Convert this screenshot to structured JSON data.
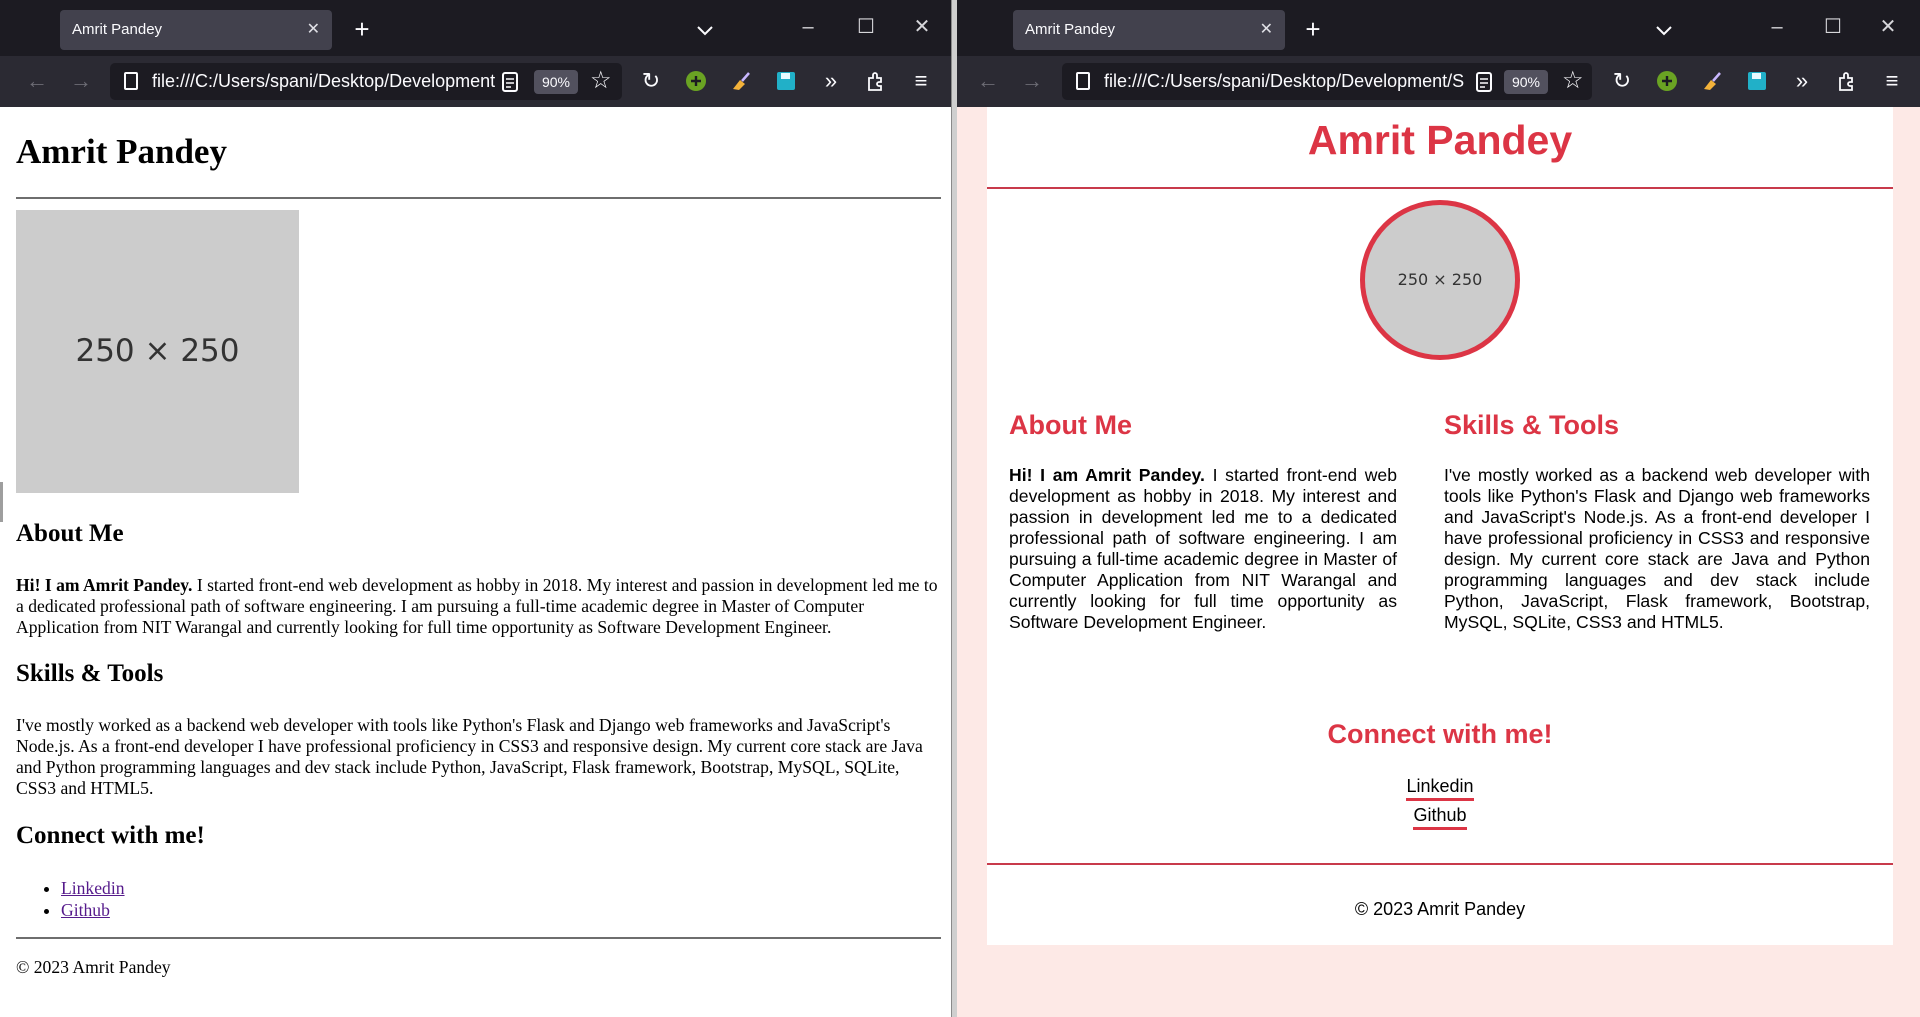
{
  "left_window": {
    "tab_title": "Amrit Pandey",
    "url": "file:///C:/Users/spani/Desktop/Development",
    "zoom": "90%"
  },
  "right_window": {
    "tab_title": "Amrit Pandey",
    "url": "file:///C:/Users/spani/Desktop/Development/S",
    "zoom": "90%"
  },
  "page": {
    "name": "Amrit Pandey",
    "placeholder_label": "250 × 250",
    "about_heading": "About Me",
    "about_intro": "Hi! I am Amrit Pandey.",
    "about_text": " I started front-end web development as hobby in 2018. My interest and passion in development led me to a dedicated professional path of software engineering. I am pursuing a full-time academic degree in Master of Computer Application from NIT Warangal and currently looking for full time opportunity as Software Development Engineer.",
    "skills_heading": "Skills & Tools",
    "skills_text": "I've mostly worked as a backend web developer with tools like Python's Flask and Django web frameworks and JavaScript's Node.js. As a front-end developer I have professional proficiency in CSS3 and responsive design. My current core stack are Java and Python programming languages and dev stack include Python, JavaScript, Flask framework, Bootstrap, MySQL, SQLite, CSS3 and HTML5.",
    "connect_heading": "Connect with me!",
    "links": [
      "Linkedin",
      "Github"
    ],
    "footer": "© 2023 Amrit Pandey"
  },
  "colors": {
    "accent": "#dc3545",
    "page_bg": "#fde9e6",
    "visited_link": "#551a8b"
  },
  "icons": {
    "back": "arrow-left-icon",
    "forward": "arrow-right-icon",
    "reload": "reload-icon",
    "bookmark": "star-icon",
    "overflow": "chevron-double-right-icon",
    "extensions": "puzzle-icon",
    "menu": "hamburger-icon"
  }
}
